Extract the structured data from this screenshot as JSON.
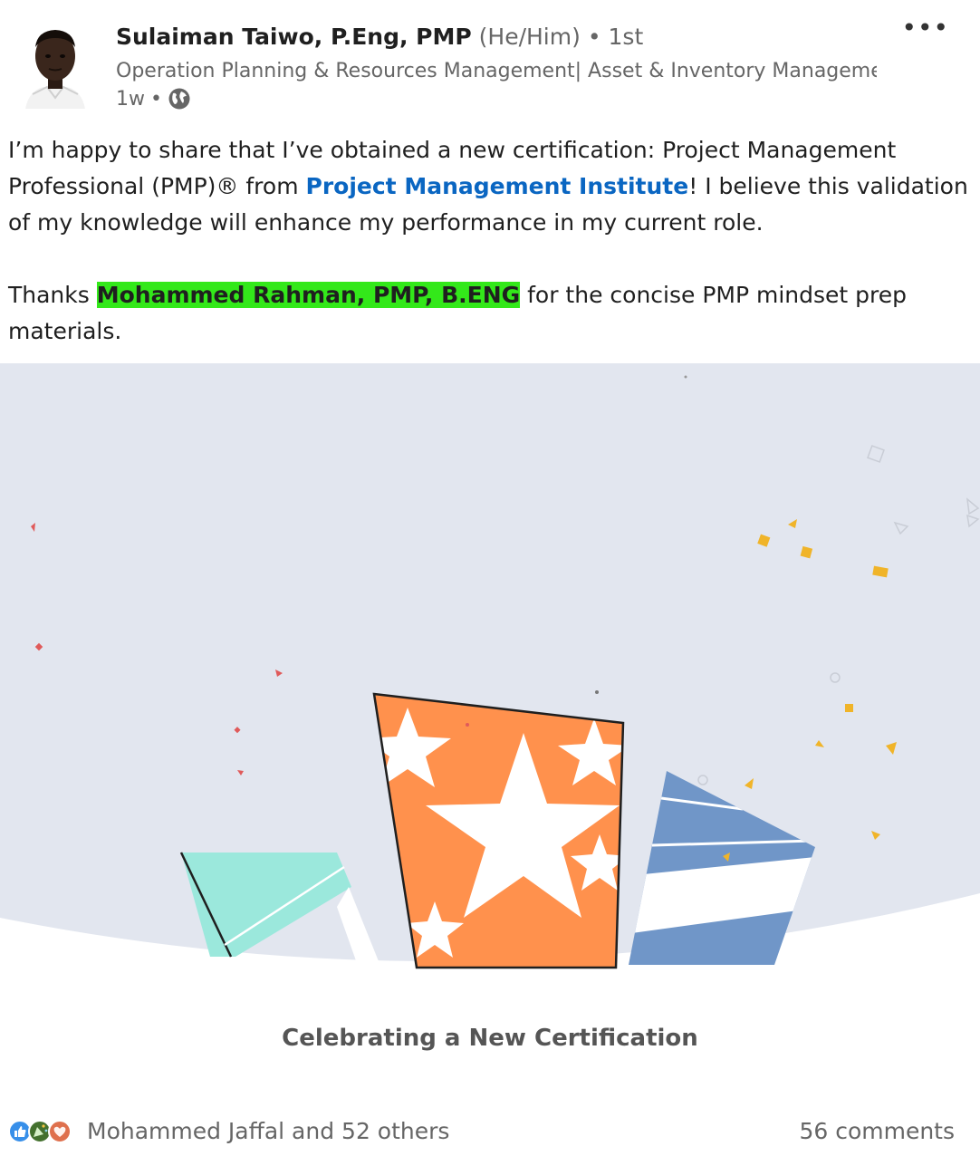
{
  "author": {
    "name": "Sulaiman Taiwo, P.Eng, PMP",
    "pronouns": "(He/Him)",
    "separator": "•",
    "degree": "1st",
    "headline": "Operation Planning & Resources Management| Asset & Inventory Manageme...",
    "time": "1w",
    "time_separator": "•",
    "visibility_icon": "globe-icon"
  },
  "menu": {
    "label": "•••",
    "icon": "more-options-icon"
  },
  "post": {
    "p1_before": "I’m happy to share that I’ve obtained a new certification: Project Management Professional (PMP)® from ",
    "p1_link": "Project Management Institute",
    "p1_after": "! I believe this validation of my knowledge will enhance my performance in my current role.",
    "p2_before": "Thanks ",
    "p2_mention": "Mohammed Rahman, PMP, B.ENG",
    "p2_after": " for the concise PMP mindset prep materials."
  },
  "media": {
    "caption": "Celebrating a New Certification",
    "colors": {
      "background": "#e2e6ef",
      "orange": "#ff914d",
      "teal": "#9be8dc",
      "blue": "#7096c8",
      "confetti_gold": "#f0b429",
      "confetti_red": "#e05a5a"
    }
  },
  "social": {
    "reactions_text": "Mohammed Jaffal and 52 others",
    "reaction_icons": [
      "like-icon",
      "celebrate-icon",
      "love-icon"
    ],
    "comments_text": "56 comments"
  },
  "colors": {
    "link": "#0a66c2",
    "mention_highlight": "#33e81a",
    "muted": "#666666"
  }
}
